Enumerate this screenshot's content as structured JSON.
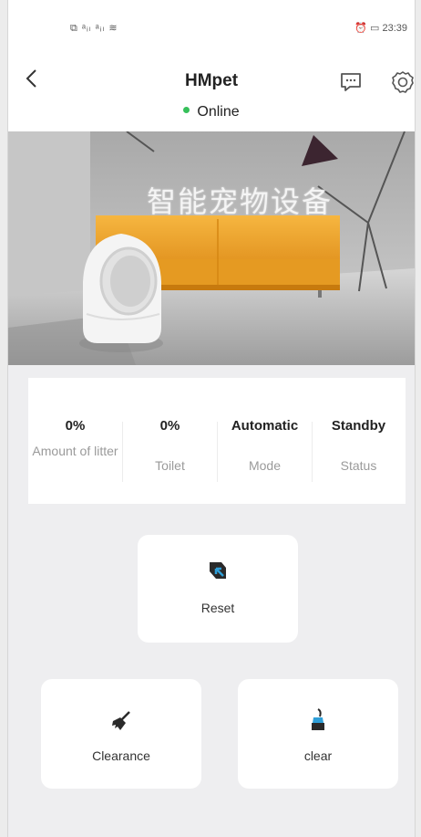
{
  "status_bar": {
    "left": "⧉ ᵃᵢₗ ᵃᵢₗ ≋",
    "right": "⏰ ▭ 23:39"
  },
  "header": {
    "title": "HMpet",
    "online_label": "Online"
  },
  "hero": {
    "overlay_text": "智能宠物设备"
  },
  "stats": [
    {
      "value": "0%",
      "label": "Amount of litter"
    },
    {
      "value": "0%",
      "label": "Toilet"
    },
    {
      "value": "Automatic",
      "label": "Mode"
    },
    {
      "value": "Standby",
      "label": "Status"
    }
  ],
  "actions": {
    "reset_label": "Reset",
    "clearance_label": "Clearance",
    "clear_label": "clear"
  },
  "colors": {
    "online_dot": "#36c05a",
    "sofa": "#f2a12a",
    "accent_blue": "#2f9fd8"
  },
  "icons": {
    "back": "chevron-left-icon",
    "message": "message-icon",
    "settings": "gear-icon",
    "reset": "reset-icon",
    "clearance": "broom-icon",
    "clear": "sweep-icon"
  }
}
